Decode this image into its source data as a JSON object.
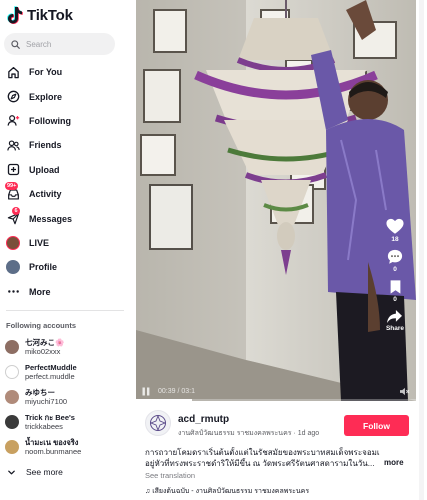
{
  "app": {
    "name": "TikTok"
  },
  "search": {
    "placeholder": "Search"
  },
  "nav": {
    "items": [
      {
        "label": "For You",
        "icon": "home-icon"
      },
      {
        "label": "Explore",
        "icon": "compass-icon"
      },
      {
        "label": "Following",
        "icon": "user-plus-icon"
      },
      {
        "label": "Friends",
        "icon": "friends-icon"
      },
      {
        "label": "Upload",
        "icon": "upload-icon"
      },
      {
        "label": "Activity",
        "icon": "inbox-icon",
        "badge": "99+"
      },
      {
        "label": "Messages",
        "icon": "send-icon",
        "badge": "6"
      },
      {
        "label": "LIVE",
        "icon": "live-avatar"
      },
      {
        "label": "Profile",
        "icon": "profile-avatar"
      },
      {
        "label": "More",
        "icon": "more-icon"
      }
    ]
  },
  "following": {
    "title": "Following accounts",
    "accounts": [
      {
        "name": "七河みこ🌸",
        "handle": "miko02xxx",
        "color": "#8d6e63"
      },
      {
        "name": "PerfectMuddle",
        "handle": "perfect.muddle",
        "color": "#c9c9c9"
      },
      {
        "name": "みゆちー",
        "handle": "miyuchi7100",
        "color": "#b08b7a"
      },
      {
        "name": "Trick กะ Bee's",
        "handle": "trickkabees",
        "color": "#3a3a3a"
      },
      {
        "name": "น้ำมะเน ของจริง",
        "handle": "noom.bunmanee",
        "color": "#c8a060"
      }
    ],
    "see_more": "See more"
  },
  "video": {
    "time": "00:39 / 03:1",
    "progress": 0.2,
    "actions": [
      {
        "icon": "heart-icon",
        "count": "18"
      },
      {
        "icon": "comment-icon",
        "count": "0"
      },
      {
        "icon": "bookmark-icon",
        "count": "0"
      },
      {
        "icon": "share-icon",
        "count": "Share"
      }
    ]
  },
  "post": {
    "author": "acd_rmutp",
    "author_sub": "งานศิลป์วัฒนธรรม ราชมงคลพระนคร · 1d ago",
    "follow_label": "Follow",
    "caption_line1": "การถวายโคมดราเริ่นต้นตั้งแต่ในรัชสมัยของพระบาทสมเด็จพระจอมเกล้าเจ้า",
    "caption_line2": "อยู่หัวที่ทรงพระราชดำริให้มีขึ้น ณ วัดพระศรีรัตนศาสดารามในวัน...",
    "more_label": "more",
    "see_translation": "See translation",
    "music": "♫ เสียงต้นฉบับ - งานศิลป์วัฒนธรรม ราชมงคลพระนคร"
  },
  "colors": {
    "accent": "#fe2c55",
    "text": "#161823"
  }
}
